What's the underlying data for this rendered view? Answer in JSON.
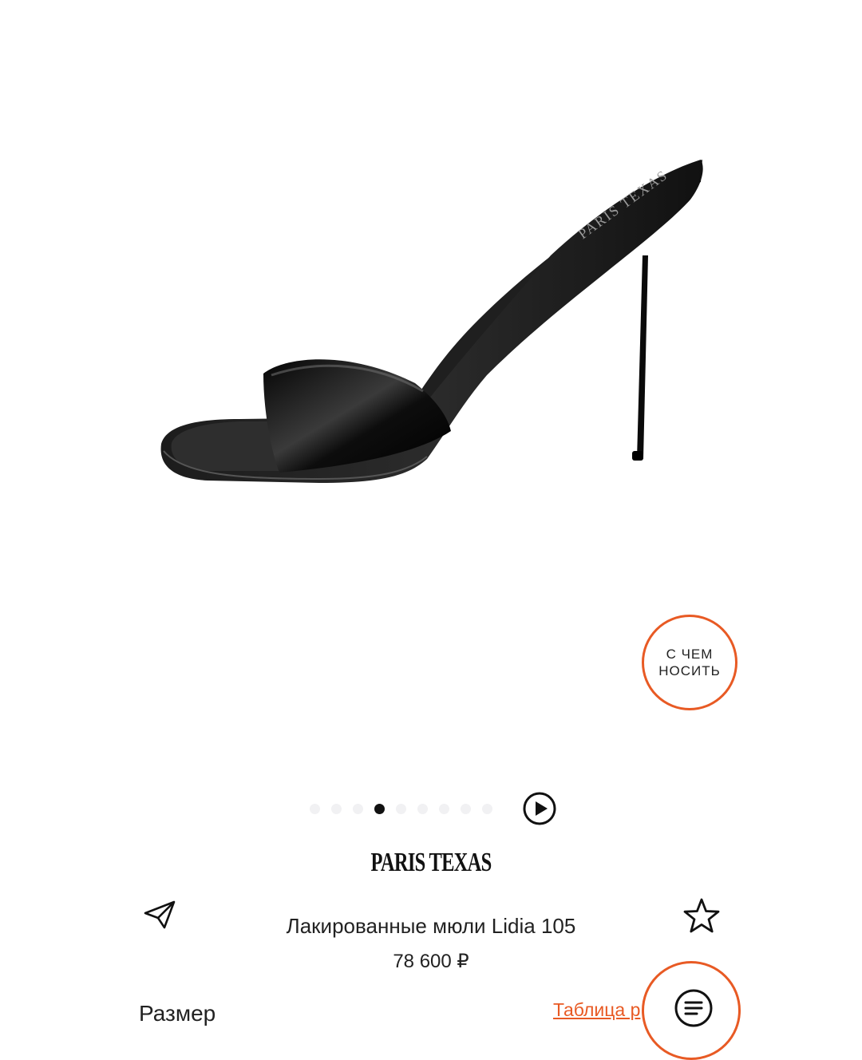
{
  "product": {
    "brand": "PARIS TEXAS",
    "title": "Лакированные мюли Lidia 105",
    "price": "78 600 ₽",
    "image_alt_icon": "product-photo"
  },
  "gallery": {
    "dot_count": 9,
    "active_dot": 4,
    "play_icon": "play-icon"
  },
  "outfit_button": {
    "label": "С ЧЕМ\nНОСИТЬ",
    "border_color": "#e85a24"
  },
  "actions": {
    "share_icon": "paper-plane-icon",
    "favorite_icon": "star-icon"
  },
  "size": {
    "label": "Размер",
    "table_link": "Таблица р"
  },
  "chat": {
    "icon": "chat-lines-icon",
    "accent_color": "#e85a24"
  }
}
